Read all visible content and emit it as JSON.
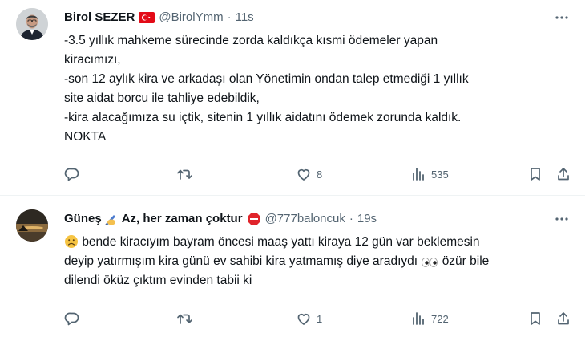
{
  "tweets": [
    {
      "author": {
        "name": "Birol SEZER",
        "handle": "@BirolYmm",
        "flag_icon": "turkey-flag-icon"
      },
      "separator": "·",
      "time": "11s",
      "lines": [
        "-3.5 yıllık mahkeme sürecinde zorda kaldıkça kısmi ödemeler yapan",
        "kiracımızı,",
        "-son 12 aylık kira ve arkadaşı olan Yönetimin ondan talep etmediği 1 yıllık",
        "site aidat borcu ile tahliye edebildik,",
        "-kira alacağımıza su içtik, sitenin 1 yıllık aidatını ödemek zorunda kaldık.",
        "NOKTA"
      ],
      "stats": {
        "replies": "",
        "retweets": "",
        "likes": "8",
        "views": "535"
      }
    },
    {
      "author": {
        "name_part1": "Güneş",
        "name_part2": "Az, her zaman çoktur",
        "handle": "@777baloncuk",
        "badge_icons": [
          "writing-hand-emoji",
          "stop-sign-emoji"
        ]
      },
      "separator": "·",
      "time": "19s",
      "line1": "bende kiracıyım bayram öncesi maaş yattı kiraya 12 gün var beklemesin",
      "line2a": "deyip yatırmışım kira günü ev sahibi kira yatmamış diye aradıydı",
      "line2b": "özür bile",
      "line3": "dilendi öküz çıktım evinden tabii ki",
      "stats": {
        "replies": "",
        "retweets": "",
        "likes": "1",
        "views": "722"
      }
    }
  ],
  "colors": {
    "text": "#0f1419",
    "secondary": "#536471",
    "divider": "#eff3f4",
    "flag_red": "#e30a17",
    "stop_red": "#e0242b"
  }
}
